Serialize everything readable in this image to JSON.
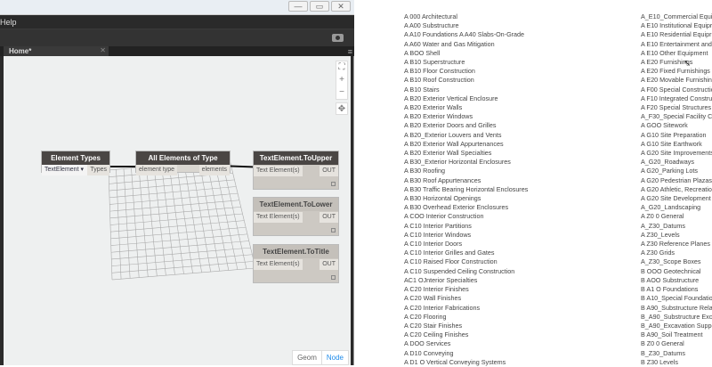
{
  "window": {
    "controls": [
      "—",
      "▭",
      "✕"
    ]
  },
  "menu": {
    "help": "Help"
  },
  "tab": {
    "label": "Home*",
    "close": "✕"
  },
  "zoom_controls": {
    "fit": "⛶",
    "zoom_in": "+",
    "zoom_out": "−",
    "pan": "✥"
  },
  "nodes": {
    "element_types": {
      "title": "Element Types",
      "dropdown": "TextElement",
      "output": "Types"
    },
    "all_elements": {
      "title": "All Elements of Type",
      "input": "element type",
      "output": "elements"
    },
    "to_upper": {
      "title": "TextElement.ToUpper",
      "input": "Text Element(s)",
      "output": "OUT"
    },
    "to_lower": {
      "title": "TextElement.ToLower",
      "input": "Text Element(s)",
      "output": "OUT"
    },
    "to_title": {
      "title": "TextElement.ToTitle",
      "input": "Text Element(s)",
      "output": "OUT"
    }
  },
  "view_toggle": {
    "geom": "Geom",
    "node": "Node"
  },
  "accent": "#1e8bea",
  "list_left": [
    "A 000 Architectural",
    "A A00 Substructure",
    "A A10 Foundations A A40 Slabs-On-Grade",
    "A A60 Water and Gas Mitigation",
    "A BOO Shell",
    "A B10 Superstructure",
    "A B10 Floor Construction",
    "A B10 Roof Construction",
    "A B10 Stairs",
    "A B20 Exterior Vertical Enclosure",
    "A B20 Exterior Walls",
    "A B20 Exterior Windows",
    "A B20 Exterior Doors and Grilles",
    "A B20_Exterior Louvers and Vents",
    "A B20 Exterior Wall Appurtenances",
    "A B20 Exterior Wall Specialties",
    "A B30_Exterior Horizontal Enclosures",
    "A B30 Roofing",
    "A B30 Roof Appurtenances",
    "A B30 Traffic Bearing Horizontal Enclosures",
    "A B30 Horizontal Openings",
    "A B30 Overhead Exterior Enclosures",
    "A COO Interior Construction",
    "A C10 Interior Partitions",
    "A C10 Interior Windows",
    "A C10 Interior Doors",
    "A C10 Interior Grilles and Gates",
    "A C10 Raised Floor Construction",
    "A C10 Suspended Ceiling Construction",
    "AC1 OJnterior Specialties",
    "A C20 Interior Finishes",
    "A C20 Wall Finishes",
    "A C20 Interior Fabrications",
    "A C20 Flooring",
    "A C20 Stair Finishes",
    "A C20 Ceiling Finishes",
    "A DOO Services",
    "A D10 Conveying",
    "A D1 O Vertical Conveying Systems"
  ],
  "list_right": [
    "A_E10_Commercial Equi",
    "A E10 Institutional Equipr",
    "A E10 Residential Equipr",
    "A E10 Entertainment and",
    "A E10 Other Equipment",
    "A E20 Furnishings",
    "A E20 Fixed Furnishings",
    "A E20 Movable Furnishing",
    "A F00 Special Constructio",
    "A F10 Integrated Constru",
    "A F20 Special Structures",
    "A_F30_Special Facility C",
    "A GOO Sitework",
    "A G10 Site Preparation",
    "A G10 Site Earthwork",
    "A G20 Site Improvements",
    "A_G20_Roadways",
    "A G20_Parking Lots",
    "A G20 Pedestrian Plazas",
    "A G20 Athletic, Recreatio",
    "A G20 Site Development",
    "A_G20_Landscaping",
    "A Z0 0 General",
    "A_Z30_Datums",
    "A Z30_Levels",
    "A Z30 Reference Planes",
    "A Z30 Grids",
    "A_Z30_Scope Boxes",
    "B OOO Geotechnical",
    "B AOO Substructure",
    "B A1 O Foundations",
    "B A10_Special Foundatio",
    "B A90_Substructure Rela",
    "B_A90_Substructure Exc",
    "B_A90_Excavation Suppo",
    "B A90_Soil Treatment",
    "B Z0 0 General",
    "B_Z30_Datums",
    "B Z30 Levels"
  ]
}
